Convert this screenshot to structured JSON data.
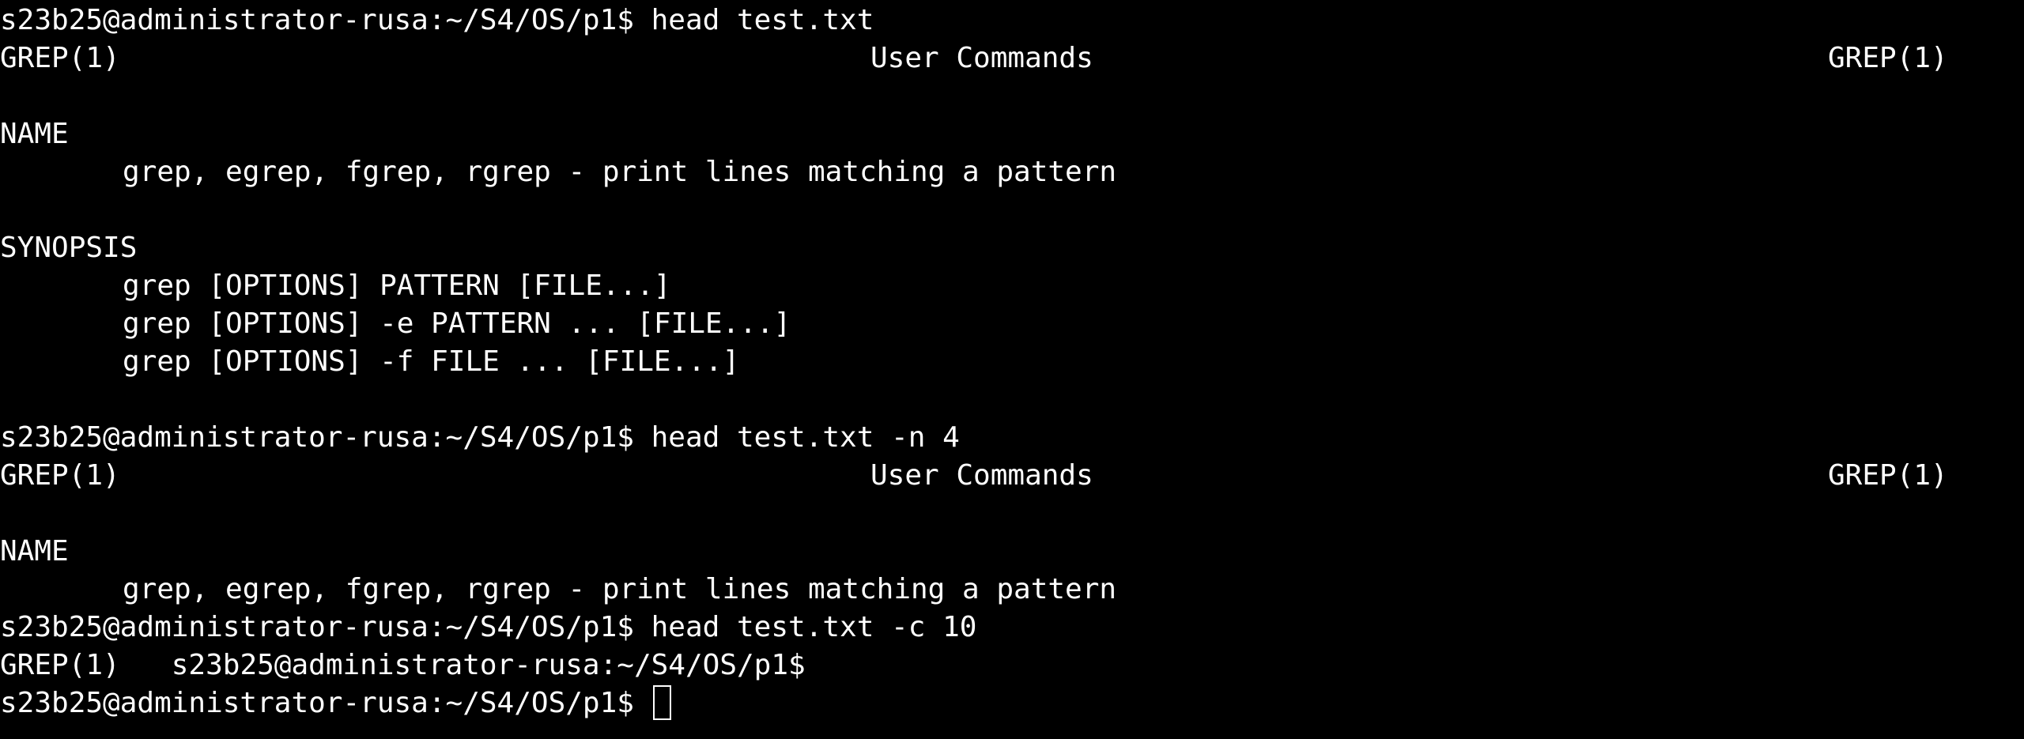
{
  "terminal": {
    "prompt": "s23b25@administrator-rusa:~/S4/OS/p1$ ",
    "commands": {
      "cmd1": "head test.txt",
      "cmd2": "head test.txt -n 4",
      "cmd3": "head test.txt -c 10",
      "current_input": ""
    },
    "manpage": {
      "header_left": "GREP(1)",
      "header_center": "User Commands",
      "header_right": "GREP(1)",
      "name_heading": "NAME",
      "name_text": "grep, egrep, fgrep, rgrep - print lines matching a pattern",
      "synopsis_heading": "SYNOPSIS",
      "synopsis_lines": [
        "grep [OPTIONS] PATTERN [FILE...]",
        "grep [OPTIONS] -e PATTERN ... [FILE...]",
        "grep [OPTIONS] -f FILE ... [FILE...]"
      ]
    },
    "c10_output": "GREP(1)   ",
    "c10_trailing_prompt": "s23b25@administrator-rusa:~/S4/OS/p1$"
  }
}
